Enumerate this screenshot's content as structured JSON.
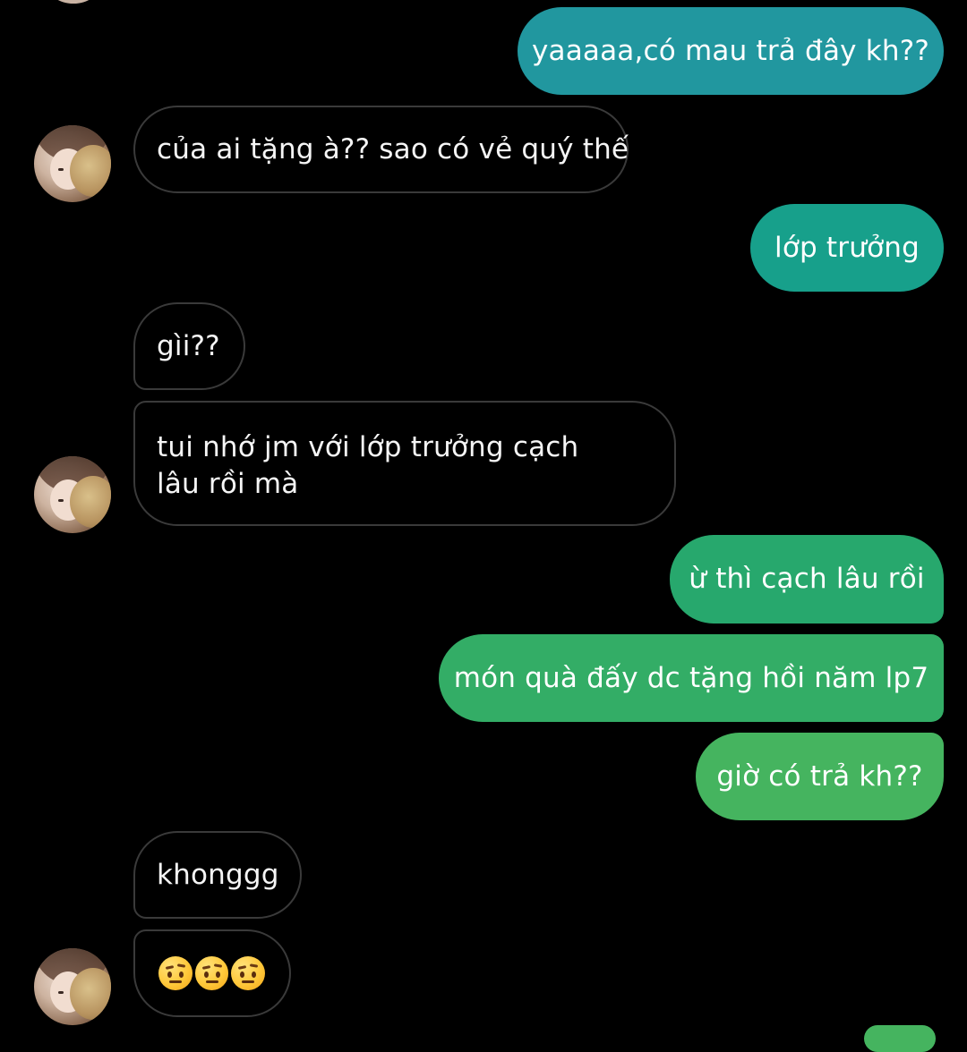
{
  "messages": [
    {
      "id": "m1",
      "side": "out",
      "text": "yaaaaa,có mau trả đây kh??",
      "color": "#21979f"
    },
    {
      "id": "m2",
      "side": "in",
      "text": "của ai tặng à?? sao có vẻ quý thế",
      "avatar": true
    },
    {
      "id": "m3",
      "side": "out",
      "text": "lớp trưởng",
      "color": "#17a08b"
    },
    {
      "id": "m4",
      "side": "in",
      "text": "gìi??"
    },
    {
      "id": "m5",
      "side": "in",
      "text": "tui nhớ jm với lớp trưởng cạch lâu rồi mà",
      "avatar": true
    },
    {
      "id": "m6",
      "side": "out",
      "text": "ừ thì cạch lâu rồi",
      "color": "#27a86d"
    },
    {
      "id": "m7",
      "side": "out",
      "text": "món quà đấy dc tặng hồi năm lp7",
      "color": "#33ad66"
    },
    {
      "id": "m8",
      "side": "out",
      "text": "giờ có trả kh??",
      "color": "#45b45f"
    },
    {
      "id": "m9",
      "side": "in",
      "text": "khonggg"
    },
    {
      "id": "m10",
      "side": "in",
      "emoji": [
        "raised-eyebrow-emoji",
        "raised-eyebrow-emoji",
        "raised-eyebrow-emoji"
      ],
      "avatar": true
    }
  ],
  "theme": {
    "background": "#000000",
    "incoming_border": "#3a3a3a",
    "incoming_text": "#f5f5f5",
    "outgoing_text": "#ffffff"
  },
  "icons": {
    "avatar": "contact-avatar-icon",
    "emoji": "face-with-raised-eyebrow-icon"
  }
}
